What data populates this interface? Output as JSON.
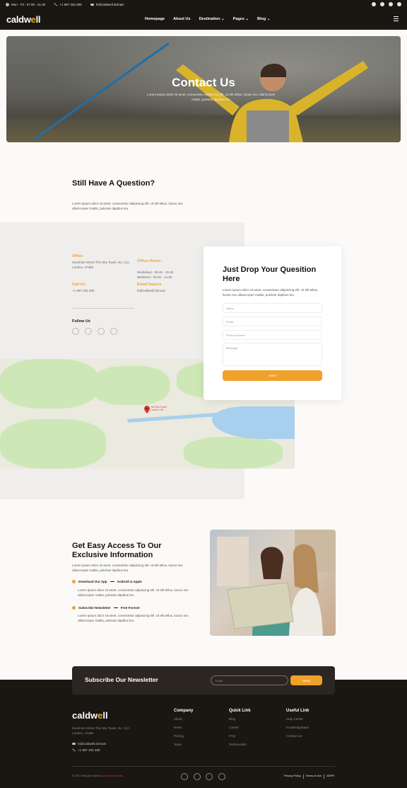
{
  "topbar": {
    "hours": "Mon - Fri : 07.00 - 21.00",
    "phone": "+1 987 333 289",
    "email": "hi@caldwell.domain"
  },
  "brand": {
    "logo_pre": "caldw",
    "logo_accent": "e",
    "logo_post": "ll"
  },
  "nav": {
    "items": [
      {
        "label": "Homepage"
      },
      {
        "label": "About Us"
      },
      {
        "label": "Destination ⌄"
      },
      {
        "label": "Pages ⌄"
      },
      {
        "label": "Blog ⌄"
      }
    ]
  },
  "hero": {
    "title": "Contact Us",
    "subtitle": "Lorem ipsum dolor sit amet, consectetur adipiscing elit. Ut elit tellus, luctus nec ullamcorper mattis, pulvinar dapibus leo."
  },
  "question": {
    "title": "Still Have A Question?",
    "text": "Lorem ipsum dolor sit amet, consectetur adipiscing elit. Ut elit tellus, luctus nec ullamcorper mattis, pulvinar dapibus leo."
  },
  "office": {
    "label": "Office",
    "value": "Sunshine Street The Sky Tower, No. 112, London, 47385"
  },
  "hours": {
    "label": "Office Hours:",
    "value": "Weekdays : 08.45 - 16.45\nWeekend : 09.00 - 14.00"
  },
  "call": {
    "label": "Call Us",
    "value": "+1 987 333 289"
  },
  "inquiry": {
    "label": "Email Inquiry",
    "value": "hi@caldwell.domain"
  },
  "follow": {
    "label": "Follow Us"
  },
  "map": {
    "pin_label": "The Sky Tower London, UK"
  },
  "form": {
    "title": "Just Drop Your Quesition Here",
    "text": "Lorem ipsum dolor sit amet, consectetur adipiscing elit. Ut elit tellus, luctus nec ullamcorper mattis, pulvinar dapibus leo.",
    "name_ph": "Name",
    "email_ph": "Email",
    "phone_ph": "Phone Number",
    "message_ph": "Message",
    "send": "Send"
  },
  "access": {
    "title": "Get Easy Access To Our Exclusive Information",
    "text": "Lorem ipsum dolor sit amet, consectetur adipiscing elit. Ut elit tellus, luctus nec ullamcorper mattis, pulvinar dapibus leo.",
    "b1_a": "Download Our App",
    "b1_b": "Android & Apple",
    "b1_text": "Lorem ipsum dolor sit amet, consectetur adipiscing elit. Ut elit tellus, luctus nec ullamcorper mattis, pulvinar dapibus leo.",
    "b2_a": "Subscribe Newsletter",
    "b2_b": "Free Forever",
    "b2_text": "Lorem ipsum dolor sit amet, consectetur adipiscing elit. Ut elit tellus, luctus nec ullamcorper mattis, pulvinar dapibus leo."
  },
  "newsletter": {
    "title": "Subscribe Our Newsletter",
    "email_ph": "Email",
    "send": "Send"
  },
  "footer": {
    "address": "Sunshine Street The Sky Tower, No. 112, London, 47385",
    "email": "hi@caldwell.domain",
    "phone": "+1 987 333 289",
    "company": {
      "title": "Company",
      "links": [
        "About",
        "News",
        "Pricing",
        "Team"
      ]
    },
    "quick": {
      "title": "Quick Link",
      "links": [
        "Blog",
        "Career",
        "FAQ",
        "Testimonials"
      ]
    },
    "useful": {
      "title": "Useful Link",
      "links": [
        "Help Center",
        "Knowledgebase",
        "Contact Us"
      ]
    },
    "copyright": "© 2021 Template Name",
    "by": "by Dewrust Studio",
    "legal": [
      "Privacy Policy",
      "Terms of Use",
      "GDPR"
    ]
  },
  "colors": {
    "accent": "#f0a12a",
    "dark": "#1a1612",
    "pin": "#d83a2f"
  }
}
